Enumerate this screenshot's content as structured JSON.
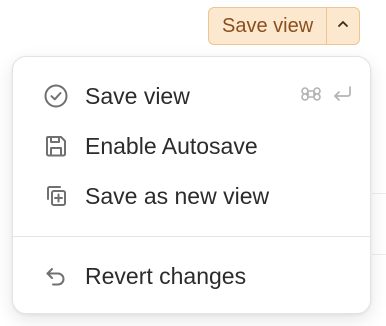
{
  "toolbar": {
    "save_view_label": "Save view",
    "caret_icon": "chevron-up-icon",
    "accent_bg": "#fce8cf",
    "accent_border": "#f0c48e",
    "accent_text": "#8a4f1c"
  },
  "menu": {
    "items": [
      {
        "label": "Save view",
        "icon": "check-circle-icon",
        "shortcut": [
          "command-icon",
          "return-icon"
        ]
      },
      {
        "label": "Enable Autosave",
        "icon": "floppy-disk-icon"
      },
      {
        "label": "Save as new view",
        "icon": "copy-plus-icon"
      },
      {
        "label": "Revert changes",
        "icon": "undo-arrow-icon"
      }
    ]
  }
}
